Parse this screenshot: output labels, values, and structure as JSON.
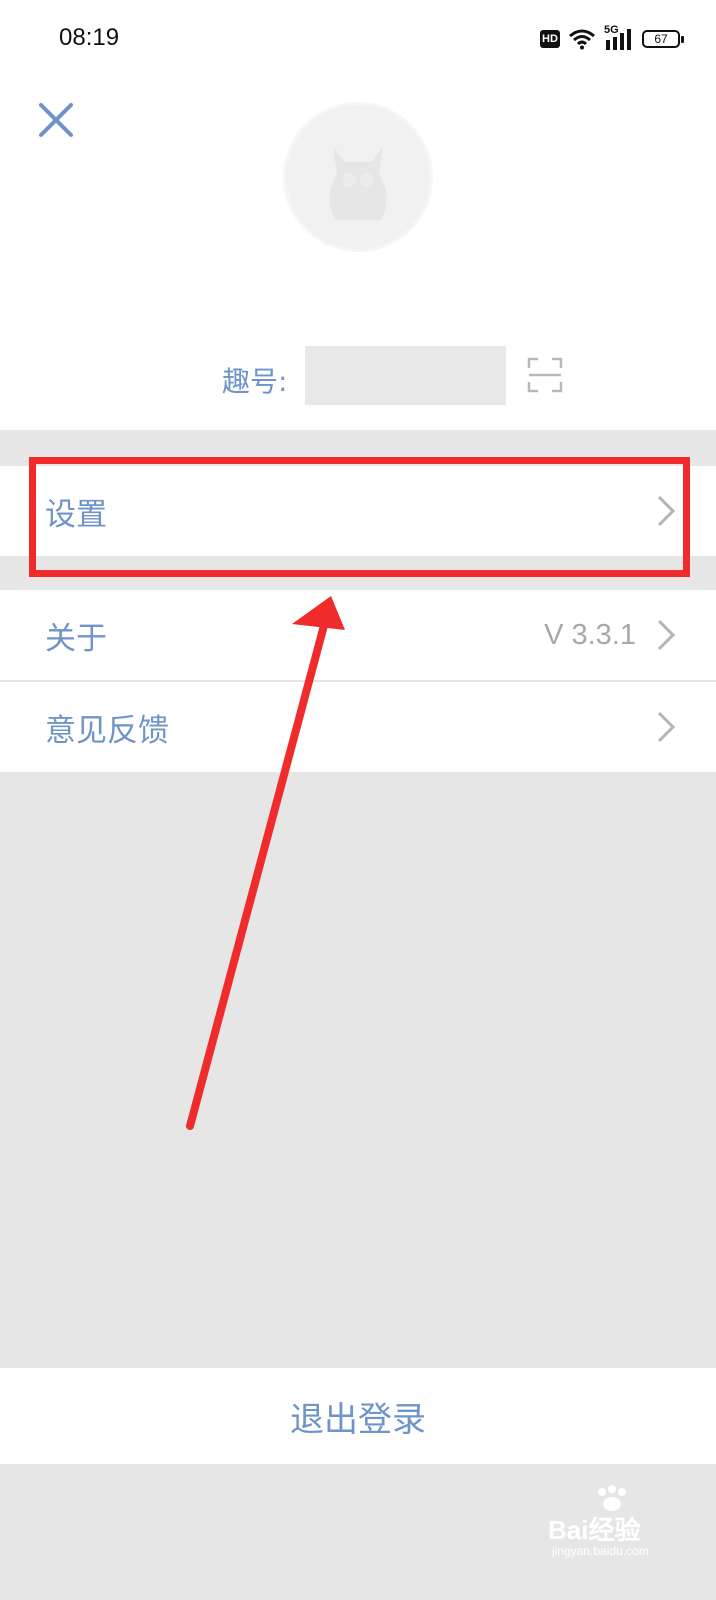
{
  "status_bar": {
    "time": "08:19",
    "hd_label": "HD",
    "network_label": "5G",
    "battery_level": "67"
  },
  "profile": {
    "id_label": "趣号:",
    "id_value": ""
  },
  "menu": {
    "items": [
      {
        "label": "设置",
        "value": ""
      },
      {
        "label": "关于",
        "value": "V 3.3.1"
      },
      {
        "label": "意见反馈",
        "value": ""
      }
    ]
  },
  "logout_label": "退出登录",
  "watermark": {
    "brand": "Bai经验",
    "url": "jingyan.baidu.com"
  },
  "colors": {
    "accent": "#6f94c9",
    "highlight": "#ef2b2b",
    "background": "#e6e6e6"
  },
  "icons": [
    "close-icon",
    "avatar",
    "scan-icon",
    "chevron-right-icon",
    "wifi-icon",
    "signal-icon",
    "battery-icon"
  ]
}
